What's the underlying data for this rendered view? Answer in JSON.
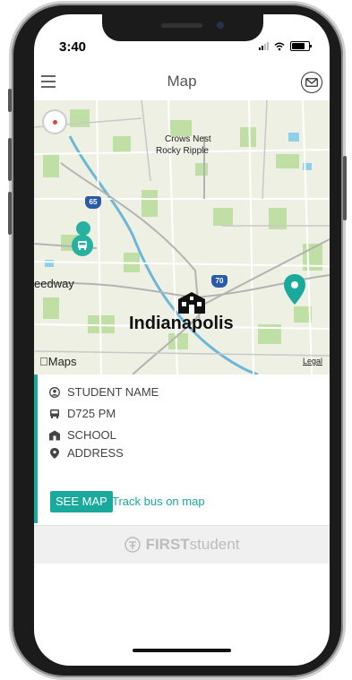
{
  "status_bar": {
    "time": "3:40"
  },
  "header": {
    "title": "Map",
    "menu_icon": "hamburger-menu-icon",
    "mail_icon": "envelope-icon"
  },
  "map": {
    "labels": {
      "crows_nest": "Crows Nest",
      "rocky_ripple": "Rocky Ripple",
      "speedway": "eedway",
      "city": "Indianapolis",
      "attribution": "Maps",
      "legal": "Legal",
      "highway_65": "65",
      "highway_70": "70"
    },
    "colors": {
      "accent": "#1aa99d"
    }
  },
  "card": {
    "student_name": "STUDENT NAME",
    "bus": "D725 PM",
    "school": "SCHOOL",
    "address": "ADDRESS",
    "see_map_label": "SEE MAP",
    "track_label": "Track bus on map"
  },
  "footer": {
    "brand_bold": "FIRST",
    "brand_rest": "student"
  }
}
